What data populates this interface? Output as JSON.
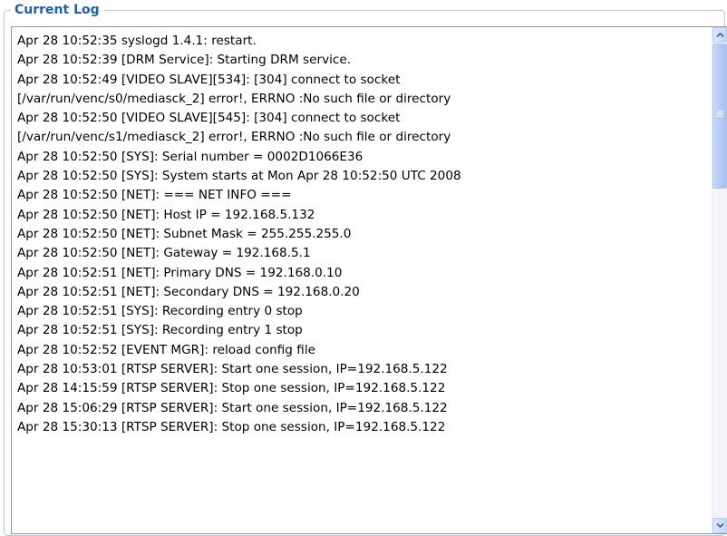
{
  "log_panel": {
    "title": "Current Log",
    "lines": [
      "Apr 28 10:52:35 syslogd 1.4.1: restart.",
      "Apr 28 10:52:39 [DRM Service]: Starting DRM service.",
      "Apr 28 10:52:49 [VIDEO SLAVE][534]: [304] connect to socket",
      "[/var/run/venc/s0/mediasck_2] error!, ERRNO :No such file or directory",
      "Apr 28 10:52:50 [VIDEO SLAVE][545]: [304] connect to socket",
      "[/var/run/venc/s1/mediasck_2] error!, ERRNO :No such file or directory",
      "Apr 28 10:52:50 [SYS]: Serial number = 0002D1066E36",
      "Apr 28 10:52:50 [SYS]: System starts at Mon Apr 28 10:52:50 UTC 2008",
      "Apr 28 10:52:50 [NET]: === NET INFO ===",
      "Apr 28 10:52:50 [NET]: Host IP = 192.168.5.132",
      "Apr 28 10:52:50 [NET]: Subnet Mask = 255.255.255.0",
      "Apr 28 10:52:50 [NET]: Gateway = 192.168.5.1",
      "Apr 28 10:52:51 [NET]: Primary DNS = 192.168.0.10",
      "Apr 28 10:52:51 [NET]: Secondary DNS = 192.168.0.20",
      "Apr 28 10:52:51 [SYS]: Recording entry 0 stop",
      "Apr 28 10:52:51 [SYS]: Recording entry 1 stop",
      "Apr 28 10:52:52 [EVENT MGR]: reload config file",
      "Apr 28 10:53:01 [RTSP SERVER]: Start one session, IP=192.168.5.122",
      "Apr 28 14:15:59 [RTSP SERVER]: Stop one session, IP=192.168.5.122",
      "Apr 28 15:06:29 [RTSP SERVER]: Start one session, IP=192.168.5.122",
      "Apr 28 15:30:13 [RTSP SERVER]: Stop one session, IP=192.168.5.122"
    ]
  },
  "scrollbar": {
    "up_icon": "scroll-up-arrow",
    "down_icon": "scroll-down-arrow",
    "position": 0.0
  },
  "colors": {
    "title": "#1f5fb0",
    "box_border": "#7f9db9",
    "scroll_thumb": "#b3c9f5"
  }
}
